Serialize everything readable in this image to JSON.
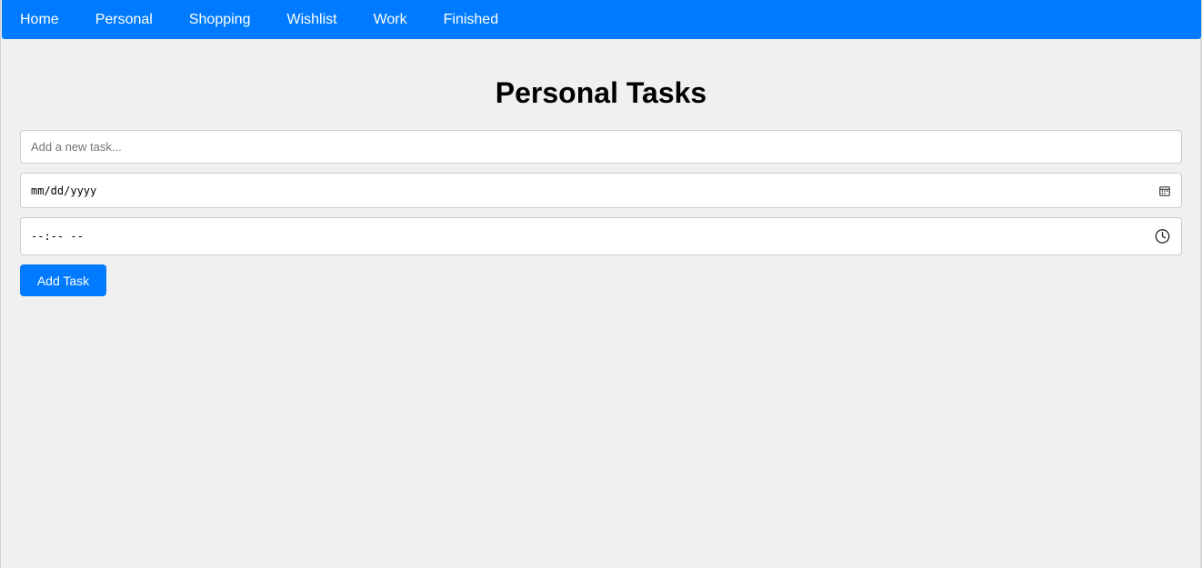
{
  "nav": {
    "items": [
      {
        "label": "Home"
      },
      {
        "label": "Personal"
      },
      {
        "label": "Shopping"
      },
      {
        "label": "Wishlist"
      },
      {
        "label": "Work"
      },
      {
        "label": "Finished"
      }
    ]
  },
  "page": {
    "title": "Personal Tasks"
  },
  "form": {
    "task_placeholder": "Add a new task...",
    "date_placeholder": "mm/dd/yyyy",
    "date_icon": "calendar-icon",
    "time_placeholder": "--:-- --",
    "time_icon": "clock-icon",
    "add_button_label": "Add Task"
  },
  "colors": {
    "accent": "#007bff",
    "background": "#f0f0f0",
    "input_border": "#cccccc"
  }
}
